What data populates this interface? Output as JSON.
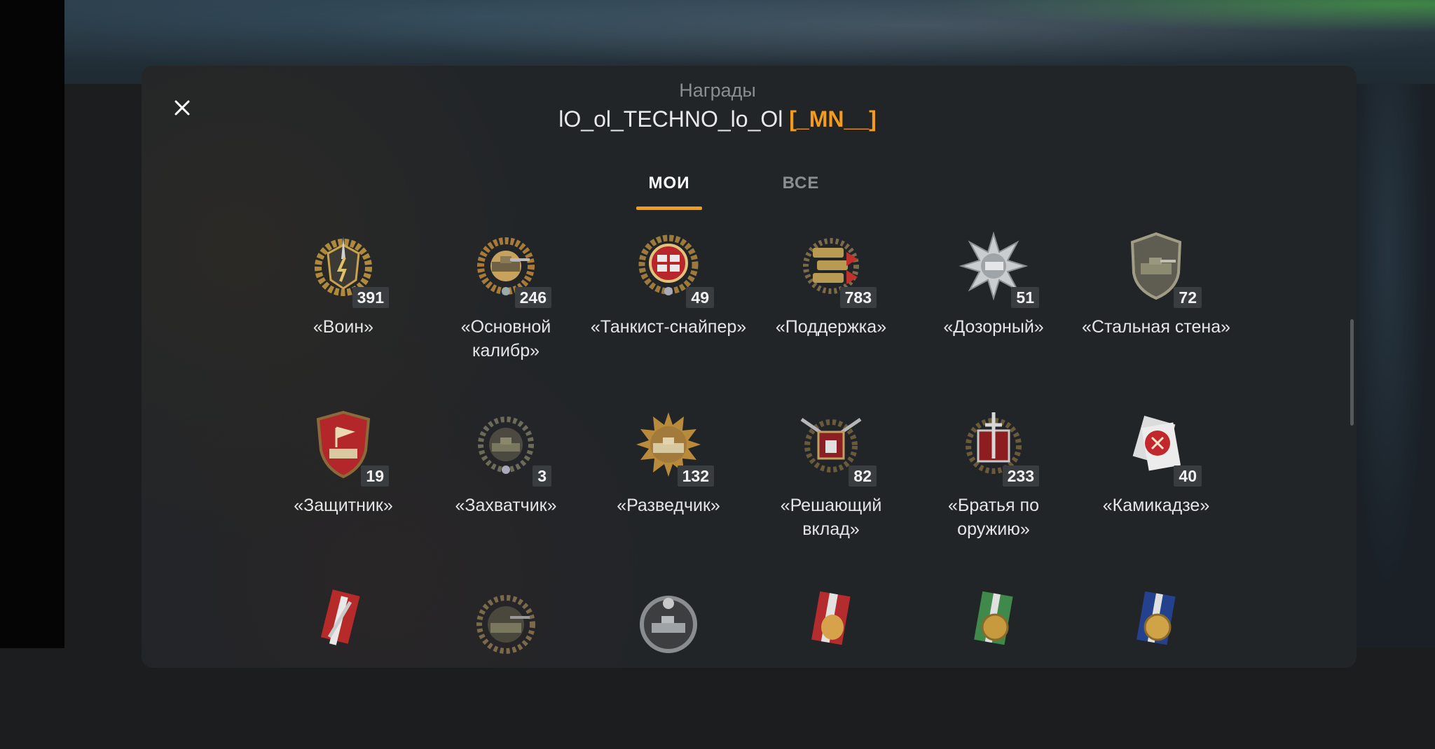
{
  "header": {
    "title": "Награды",
    "player_name": "lO_ol_TECHNO_lo_Ol",
    "clan_tag": "[_MN__]"
  },
  "tabs": [
    {
      "label": "МОИ",
      "active": true
    },
    {
      "label": "ВСЕ",
      "active": false
    }
  ],
  "colors": {
    "accent": "#f39b1c",
    "panel": "#222528",
    "text": "#e4e5e6"
  },
  "medals": [
    {
      "label": "«Воин»",
      "count": "391",
      "icon": "warrior-medal-icon"
    },
    {
      "label": "«Основной калибр»",
      "count": "246",
      "icon": "main-caliber-medal-icon"
    },
    {
      "label": "«Танкист-снайпер»",
      "count": "49",
      "icon": "sniper-medal-icon"
    },
    {
      "label": "«Поддержка»",
      "count": "783",
      "icon": "support-medal-icon"
    },
    {
      "label": "«Дозорный»",
      "count": "51",
      "icon": "spotter-medal-icon"
    },
    {
      "label": "«Стальная стена»",
      "count": "72",
      "icon": "steel-wall-medal-icon"
    },
    {
      "label": "«Защитник»",
      "count": "19",
      "icon": "defender-medal-icon"
    },
    {
      "label": "«Захватчик»",
      "count": "3",
      "icon": "invader-medal-icon"
    },
    {
      "label": "«Разведчик»",
      "count": "132",
      "icon": "scout-medal-icon"
    },
    {
      "label": "«Решающий вклад»",
      "count": "82",
      "icon": "decisive-contribution-medal-icon"
    },
    {
      "label": "«Братья по оружию»",
      "count": "233",
      "icon": "brothers-in-arms-medal-icon"
    },
    {
      "label": "«Камикадзе»",
      "count": "40",
      "icon": "kamikaze-medal-icon"
    }
  ],
  "partial_medals": [
    {
      "icon": "red-ribbon-medal-icon"
    },
    {
      "icon": "tank-wreath-medal-icon"
    },
    {
      "icon": "silver-tank-medal-icon"
    },
    {
      "icon": "tiger-ribbon-medal-icon"
    },
    {
      "icon": "green-ribbon-medal-icon"
    },
    {
      "icon": "blue-ribbon-medal-icon"
    }
  ]
}
